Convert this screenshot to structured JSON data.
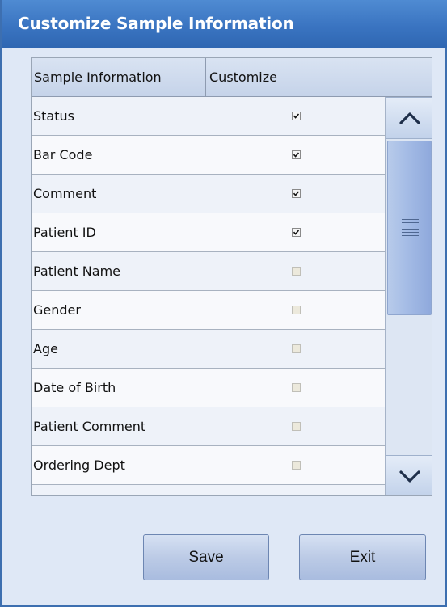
{
  "dialog": {
    "title": "Customize Sample Information"
  },
  "table": {
    "columns": [
      "Sample Information",
      "Customize"
    ],
    "rows": [
      {
        "label": "Status",
        "checked": true,
        "enabled": true
      },
      {
        "label": "Bar Code",
        "checked": true,
        "enabled": true
      },
      {
        "label": "Comment",
        "checked": true,
        "enabled": true
      },
      {
        "label": "Patient ID",
        "checked": true,
        "enabled": true
      },
      {
        "label": "Patient Name",
        "checked": false,
        "enabled": false
      },
      {
        "label": "Gender",
        "checked": false,
        "enabled": false
      },
      {
        "label": "Age",
        "checked": false,
        "enabled": false
      },
      {
        "label": "Date of Birth",
        "checked": false,
        "enabled": false
      },
      {
        "label": "Patient Comment",
        "checked": false,
        "enabled": false
      },
      {
        "label": "Ordering Dept",
        "checked": false,
        "enabled": false
      }
    ]
  },
  "scrollbar": {
    "up_icon": "chevron-up-icon",
    "down_icon": "chevron-down-icon",
    "grip_icon": "grip-lines-icon"
  },
  "buttons": {
    "save": "Save",
    "exit": "Exit"
  },
  "colors": {
    "title_bar": "#3a74c1",
    "background": "#dfe8f6",
    "button": "#bccbe6"
  }
}
